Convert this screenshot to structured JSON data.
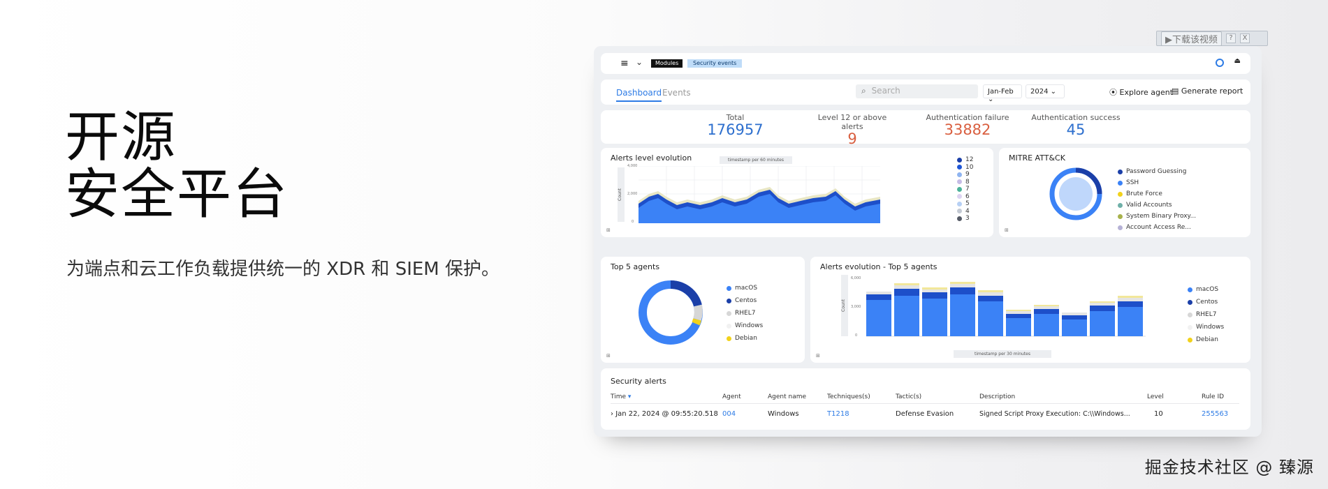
{
  "hero": {
    "title_line1": "开源",
    "title_line2": "安全平台",
    "subtitle": "为端点和云工作负载提供统一的 XDR 和 SIEM 保护。"
  },
  "watermark": "掘金技术社区 @ 臻源",
  "video_toolbar": {
    "download_label": "▶下载该视频",
    "help": "?",
    "close": "X"
  },
  "dashboard": {
    "breadcrumb": [
      "Modules",
      "Security events"
    ],
    "tabs": [
      "Dashboard",
      "Events"
    ],
    "search_placeholder": "Search",
    "period": "Jan-Feb",
    "year": "2024",
    "explore_agent": "Explore agent",
    "generate_report": "Generate report",
    "stats": [
      {
        "label": "Total",
        "value": "176957",
        "color": "#2d6fce"
      },
      {
        "label": "Level 12 or above alerts",
        "value": "9",
        "color": "#d95f40"
      },
      {
        "label": "Authentication failure",
        "value": "33882",
        "color": "#d95f40"
      },
      {
        "label": "Authentication success",
        "value": "45",
        "color": "#2d6fce"
      }
    ],
    "alerts_level": {
      "title": "Alerts level evolution",
      "x_caption": "timestamp per 60 minutes",
      "y_caption": "Count",
      "y_ticks": [
        "4,000",
        "2,000",
        "0"
      ],
      "legend": [
        {
          "label": "12",
          "color": "#1b3fa8"
        },
        {
          "label": "10",
          "color": "#1e56d6"
        },
        {
          "label": "9",
          "color": "#8fb4f0"
        },
        {
          "label": "8",
          "color": "#c6bce6"
        },
        {
          "label": "7",
          "color": "#4cb29a"
        },
        {
          "label": "6",
          "color": "#dcd3f1"
        },
        {
          "label": "5",
          "color": "#b7d0f4"
        },
        {
          "label": "4",
          "color": "#c3c9d3"
        },
        {
          "label": "3",
          "color": "#555a66"
        }
      ]
    },
    "mitre": {
      "title": "MITRE ATT&CK",
      "legend": [
        {
          "label": "Password Guessing",
          "color": "#1b3fa8"
        },
        {
          "label": "SSH",
          "color": "#3b82f6"
        },
        {
          "label": "Brute Force",
          "color": "#f2d21b"
        },
        {
          "label": "Valid Accounts",
          "color": "#6fb0a8"
        },
        {
          "label": "System Binary Proxy...",
          "color": "#a8b24c"
        },
        {
          "label": "Account Access Re...",
          "color": "#b6b2d6"
        }
      ]
    },
    "top_agents": {
      "title": "Top 5 agents",
      "legend": [
        {
          "label": "macOS",
          "color": "#3b82f6"
        },
        {
          "label": "Centos",
          "color": "#1b3fa8"
        },
        {
          "label": "RHEL7",
          "color": "#d7d7d7"
        },
        {
          "label": "Windows",
          "color": "#f1f1f1"
        },
        {
          "label": "Debian",
          "color": "#f2d21b"
        }
      ]
    },
    "alerts_top5": {
      "title": "Alerts evolution - Top 5 agents",
      "x_caption": "timestamp per 30 minutes",
      "y_caption": "Count",
      "y_ticks": [
        "6,000",
        "3,000",
        "0"
      ],
      "legend": [
        {
          "label": "macOS",
          "color": "#3b82f6"
        },
        {
          "label": "Centos",
          "color": "#1b3fa8"
        },
        {
          "label": "RHEL7",
          "color": "#d7d7d7"
        },
        {
          "label": "Windows",
          "color": "#f1f1f1"
        },
        {
          "label": "Debian",
          "color": "#f2d21b"
        }
      ]
    },
    "security_alerts": {
      "title": "Security alerts",
      "columns": [
        "Time",
        "Agent",
        "Agent name",
        "Techniques(s)",
        "Tactic(s)",
        "Description",
        "Level",
        "Rule ID"
      ],
      "rows": [
        [
          "Jan 22, 2024 @ 09:55:20.518",
          "004",
          "Windows",
          "T1218",
          "Defense Evasion",
          "Signed Script Proxy Execution: C:\\\\Windows...",
          "10",
          "255563"
        ]
      ]
    }
  }
}
